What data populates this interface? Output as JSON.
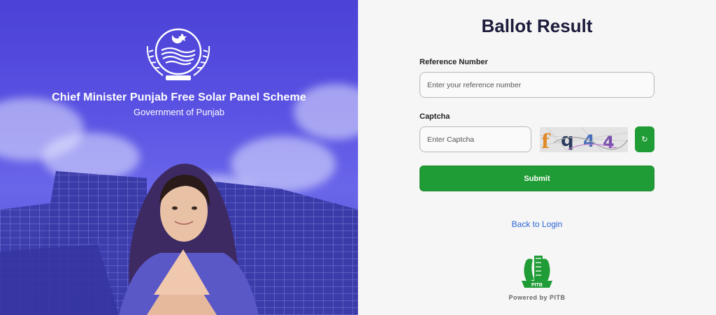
{
  "hero": {
    "title": "Chief Minister Punjab Free Solar Panel Scheme",
    "subtitle": "Government of Punjab",
    "emblem_icon": "punjab-emblem-icon",
    "colors": {
      "background": "#4b41d6",
      "text": "#ffffff"
    }
  },
  "form": {
    "title": "Ballot Result",
    "reference": {
      "label": "Reference Number",
      "placeholder": "Enter your reference number",
      "value": ""
    },
    "captcha": {
      "label": "Captcha",
      "placeholder": "Enter Captcha",
      "value": "",
      "image_text": "fq44",
      "refresh_icon": "refresh-icon"
    },
    "submit_label": "Submit",
    "back_link": "Back to Login",
    "powered_by": "Powered by PITB",
    "logo_text": "PITB",
    "colors": {
      "accent": "#1f9c35",
      "link": "#2a66d6",
      "title": "#1c1c3c"
    }
  }
}
